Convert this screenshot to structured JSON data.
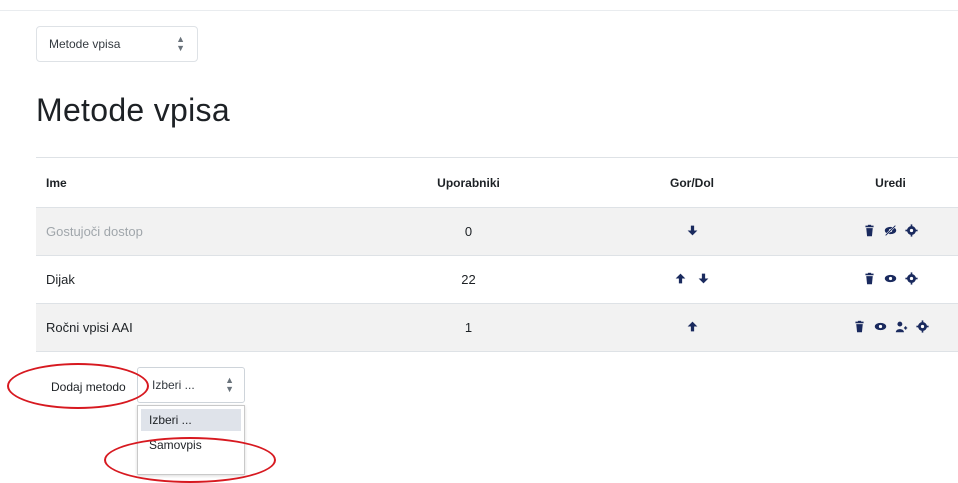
{
  "selector": {
    "value": "Metode vpisa"
  },
  "page_title": "Metode vpisa",
  "table": {
    "headers": {
      "name": "Ime",
      "users": "Uporabniki",
      "move": "Gor/Dol",
      "edit": "Uredi"
    },
    "rows": [
      {
        "name": "Gostujoči dostop",
        "users": "0"
      },
      {
        "name": "Dijak",
        "users": "22"
      },
      {
        "name": "Ročni vpisi AAI",
        "users": "1"
      }
    ]
  },
  "add_method": {
    "label": "Dodaj metodo",
    "select_value": "Izberi ...",
    "options": [
      "Izberi ...",
      "Samovpis"
    ]
  },
  "colors": {
    "icon": "#1a2a5e",
    "annotation": "#d71920",
    "muted_text": "#a0a6ab"
  },
  "icons": [
    "trash-icon",
    "eye-icon",
    "eye-slash-icon",
    "gear-icon",
    "user-plus-icon",
    "arrow-up-icon",
    "arrow-down-icon"
  ]
}
